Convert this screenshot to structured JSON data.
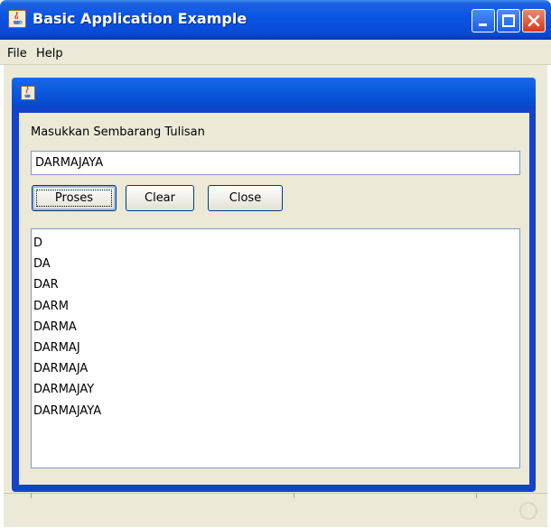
{
  "window": {
    "title": "Basic Application Example",
    "icon": "java-cup-icon",
    "controls": [
      "minimize-icon",
      "maximize-icon",
      "close-icon"
    ]
  },
  "menubar": {
    "items": [
      "File",
      "Help"
    ]
  },
  "internal_frame": {
    "icon": "java-cup-icon"
  },
  "form": {
    "prompt_label": "Masukkan Sembarang Tulisan",
    "input_value": "DARMAJAYA",
    "buttons": {
      "proses": "Proses",
      "clear": "Clear",
      "close": "Close"
    },
    "output_lines": [
      "D",
      "DA",
      "DAR",
      "DARM",
      "DARMA",
      "DARMAJ",
      "DARMAJA",
      "DARMAJAY",
      "DARMAJAYA"
    ]
  },
  "colors": {
    "titlebar_blue": "#0a55e3",
    "window_face": "#ece9d8",
    "close_red": "#d3391a"
  }
}
